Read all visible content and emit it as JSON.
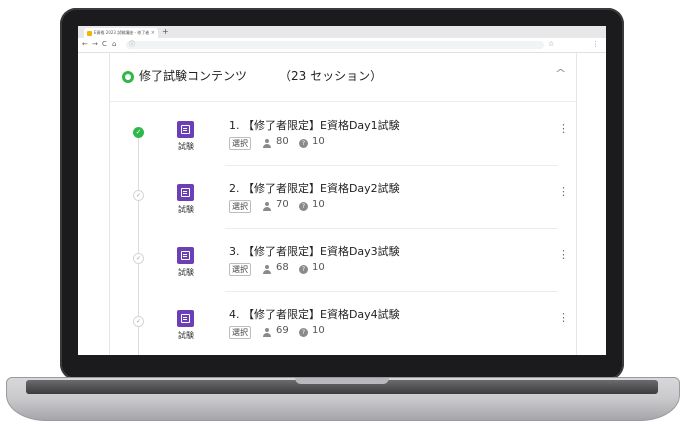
{
  "browser": {
    "tab_title": "E資格 2023 試験講座 - 修了者",
    "tab_close": "×",
    "new_tab": "+",
    "nav_back": "←",
    "nav_forward": "→",
    "nav_reload": "C",
    "nav_home": "⌂",
    "url": "",
    "omnibox_icon": "ⓘ"
  },
  "section": {
    "title": "修了試験コンテンツ",
    "count": "（23 セッション）",
    "status_color": "#2fb94a"
  },
  "items": [
    {
      "title": "1. 【修了者限定】E資格Day1試験",
      "type": "試験",
      "badge": "選択",
      "users": "80",
      "questions": "10",
      "status": "done"
    },
    {
      "title": "2. 【修了者限定】E資格Day2試験",
      "type": "試験",
      "badge": "選択",
      "users": "70",
      "questions": "10",
      "status": "todo"
    },
    {
      "title": "3. 【修了者限定】E資格Day3試験",
      "type": "試験",
      "badge": "選択",
      "users": "68",
      "questions": "10",
      "status": "todo"
    },
    {
      "title": "4. 【修了者限定】E資格Day4試験",
      "type": "試験",
      "badge": "選択",
      "users": "69",
      "questions": "10",
      "status": "todo"
    }
  ],
  "colors": {
    "exam_icon": "#6b3fb6",
    "done": "#2fb94a"
  },
  "icons": {
    "done_mark": "✓",
    "todo_mark": "✓",
    "question_mark": "?",
    "more": "⋮",
    "collapse": "^"
  }
}
